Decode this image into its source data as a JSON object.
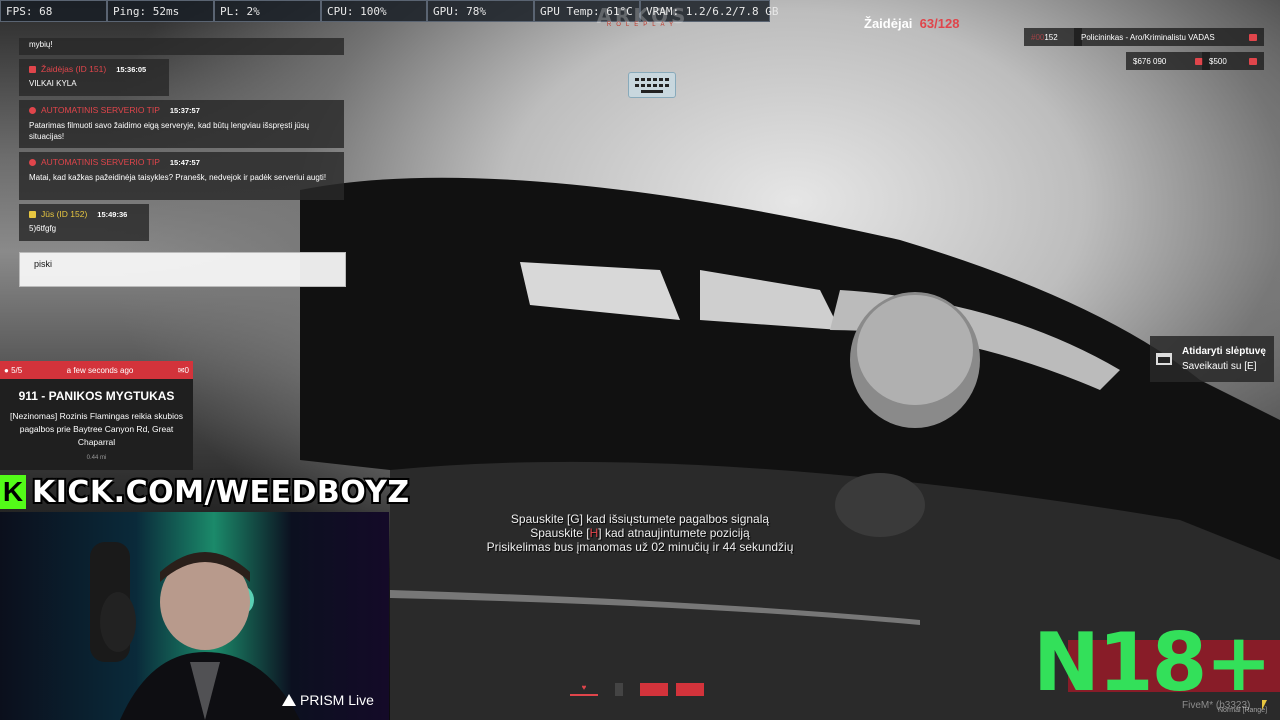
{
  "perf_bar": [
    {
      "key": "fps",
      "label": "FPS: 68"
    },
    {
      "key": "ping",
      "label": "Ping: 52ms"
    },
    {
      "key": "pl",
      "label": "PL: 2%"
    },
    {
      "key": "cpu",
      "label": "CPU: 100%"
    },
    {
      "key": "gpu",
      "label": "GPU: 78%"
    },
    {
      "key": "gputemp",
      "label": "GPU Temp: 61°C"
    },
    {
      "key": "vram",
      "label": "VRAM: 1.2/6.2/7.8 GB"
    }
  ],
  "brand": {
    "name": "ARKOS",
    "sub": "ROLEPLAY"
  },
  "players": {
    "label": "Žaidėjai",
    "count": "63/128"
  },
  "hud": {
    "id_prefix": "#00",
    "id_value": "152",
    "job": "Policininkas - Aro/Kriminalistu VADAS",
    "bank": "$676 090",
    "cash": "$500"
  },
  "chat": {
    "messages": [
      {
        "text": "mybių!"
      },
      {
        "author": "Žaidėjas (ID 151)",
        "time": "15:36:05",
        "text": "VILKAI KYLA"
      },
      {
        "author": "AUTOMATINIS SERVERIO TIP",
        "time": "15:37:57",
        "text": "Patarimas filmuoti savo žaidimo eigą serveryje, kad būtų lengviau išspręsti jūsų situacijas!"
      },
      {
        "author": "AUTOMATINIS SERVERIO TIP",
        "time": "15:47:57",
        "text": "Matai, kad kažkas pažeidinėja taisykles? Pranešk, nedvejok ir padėk serveriui augti!"
      },
      {
        "author": "Jūs (ID 152)",
        "time": "15:49:36",
        "text": "5)6tfgfg"
      }
    ],
    "input_value": "piski"
  },
  "panic": {
    "counter": "5/5",
    "time": "a few seconds ago",
    "badge": "0",
    "title": "911 - PANIKOS MYGTUKAS",
    "body": "[Nezinomas] Rozinis Flamingas reikia skubios pagalbos prie Baytree Canyon Rd, Great Chaparral",
    "distance": "0.44 mi"
  },
  "stream": {
    "kick_letter": "K",
    "kick_url": "KICK.COM/WEEDBOYZ",
    "prism": "PRISM Live"
  },
  "death": {
    "line1": "Spauskite [G] kad išsiųstumete pagalbos signalą",
    "line2_pre": "Spauskite [",
    "line2_key": "H",
    "line2_post": "] kad atnaujintumete poziciją",
    "line3": "Prisikelimas bus įmanomas už 02 minučių ir 44 sekundžių"
  },
  "interaction": {
    "title": "Atidaryti slėptuvę",
    "subtitle": "Saveikauti su [E]"
  },
  "overlay": {
    "n18": "N18+",
    "fivem": "FiveM* (b3323)",
    "mode": "Normal [Range]"
  },
  "colors": {
    "accent_red": "#e0454b",
    "own_yellow": "#e7c640",
    "kick_green": "#53fc18",
    "n18_green": "#33e05a"
  }
}
